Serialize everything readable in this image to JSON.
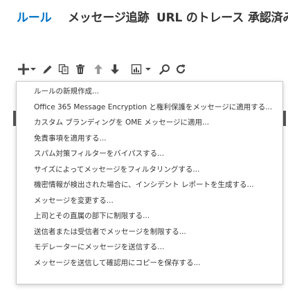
{
  "tabs": [
    {
      "label": "ルール",
      "active": true
    },
    {
      "label": "メッセージ追跡",
      "active": false
    },
    {
      "label": "URL のトレース",
      "active": false
    },
    {
      "label": "承認済み",
      "active": false
    }
  ],
  "toolbar": {
    "icons": [
      "add-icon",
      "dropdown-caret-icon",
      "edit-icon",
      "copy-icon",
      "delete-icon",
      "move-up-icon",
      "move-down-icon",
      "report-icon",
      "dropdown-caret-icon",
      "search-icon",
      "refresh-icon"
    ]
  },
  "colors": {
    "accent": "#0072c6",
    "text": "#333333",
    "icon": "#444444"
  },
  "menu": {
    "items": [
      "ルールの新規作成...",
      "Office 365 Message Encryption と権利保護をメッセージに適用する...",
      "カスタム ブランディングを OME メッセージに適用...",
      "免責事項を適用する...",
      "スパム対策フィルターをバイパスする...",
      "サイズによってメッセージをフィルタリングする...",
      "機密情報が検出された場合に、インシデント レポートを生成する...",
      "メッセージを変更する...",
      "上司とその直属の部下に制限する...",
      "送信者または受信者でメッセージを制限する...",
      "モデレーターにメッセージを送信する...",
      "メッセージを送信して確認用にコピーを保存する..."
    ]
  }
}
